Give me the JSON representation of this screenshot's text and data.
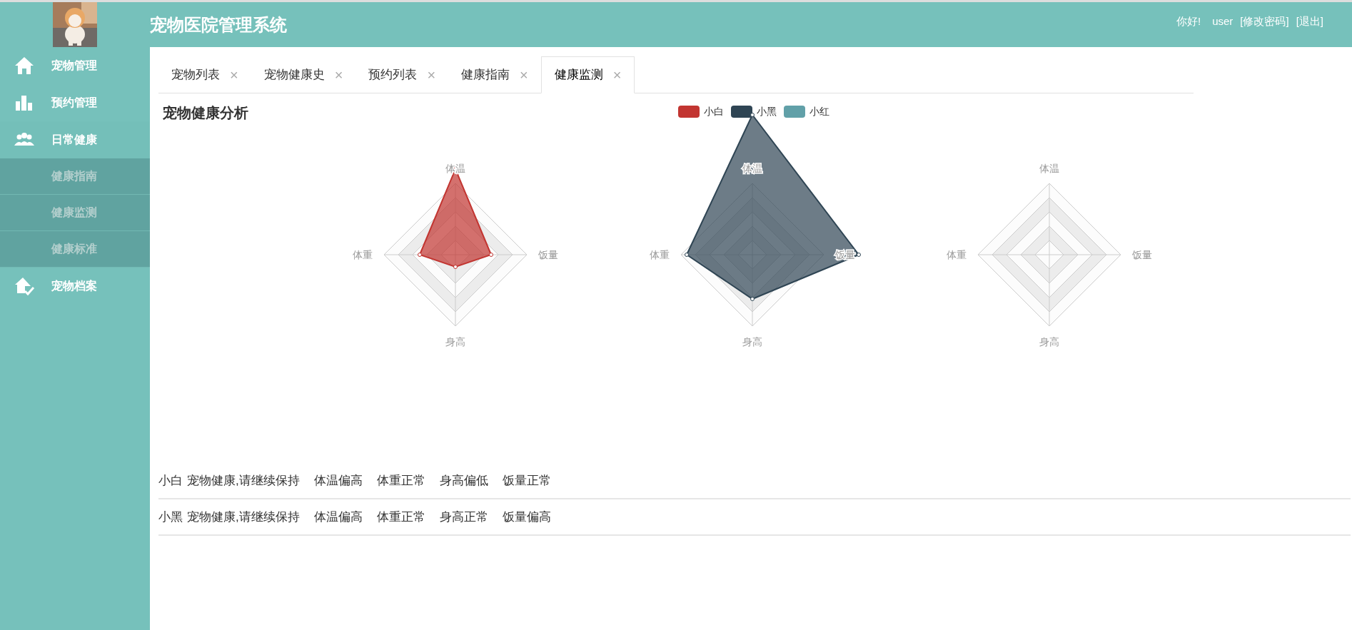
{
  "header": {
    "title": "宠物医院管理系统",
    "greeting": "你好!",
    "user": "user",
    "links": [
      "[修改密码]",
      "[退出]"
    ]
  },
  "sidebar": {
    "items": [
      {
        "label": "宠物管理"
      },
      {
        "label": "预约管理"
      },
      {
        "label": "日常健康",
        "expanded": true,
        "children": [
          {
            "label": "健康指南"
          },
          {
            "label": "健康监测"
          },
          {
            "label": "健康标准"
          }
        ]
      },
      {
        "label": "宠物档案"
      }
    ]
  },
  "tabs": [
    {
      "label": "宠物列表",
      "selected": false,
      "close": "×"
    },
    {
      "label": "宠物健康史",
      "selected": false,
      "close": "×"
    },
    {
      "label": "预约列表",
      "selected": false,
      "close": "×"
    },
    {
      "label": "健康指南",
      "selected": false,
      "close": "×"
    },
    {
      "label": "健康监测",
      "selected": true,
      "close": "×"
    }
  ],
  "panel": {
    "title": "宠物健康分析",
    "legend": [
      {
        "label": "小白",
        "color": "#c23531"
      },
      {
        "label": "小黑",
        "color": "#2f4554"
      },
      {
        "label": "小红",
        "color": "#61a0a8"
      }
    ],
    "radar_charts": [
      {
        "axes": [
          "体温",
          "饭量",
          "身高",
          "体重"
        ]
      },
      {
        "axes": [
          "体温",
          "饭量",
          "身高",
          "体重"
        ]
      },
      {
        "axes": [
          "体温",
          "饭量",
          "身高",
          "体重"
        ]
      }
    ],
    "rows": [
      {
        "name": "小白",
        "message": "宠物健康,请继续保持",
        "statuses": [
          "体温偏高",
          "体重正常",
          "身高偏低",
          "饭量正常"
        ]
      },
      {
        "name": "小黑",
        "message": "宠物健康,请继续保持",
        "statuses": [
          "体温偏高",
          "体重正常",
          "身高正常",
          "饭量偏高"
        ]
      }
    ]
  }
}
